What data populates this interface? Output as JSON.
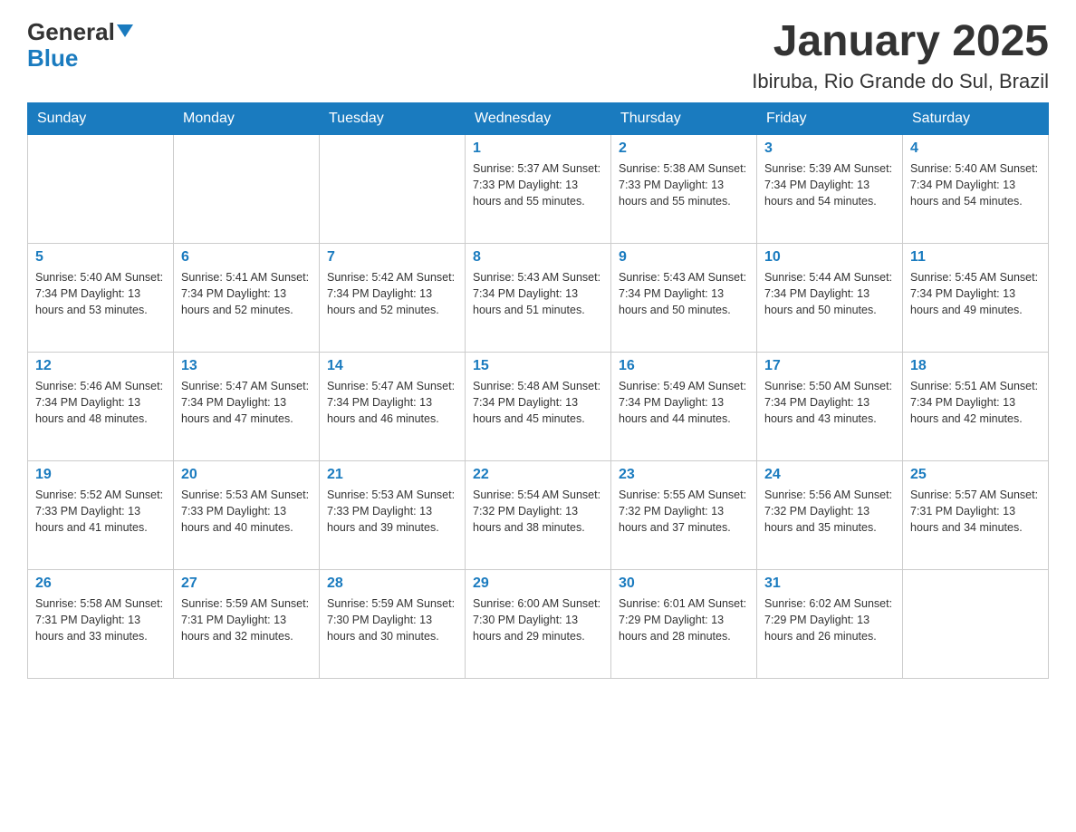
{
  "header": {
    "logo_general": "General",
    "logo_blue": "Blue",
    "month_title": "January 2025",
    "location": "Ibiruba, Rio Grande do Sul, Brazil"
  },
  "days_of_week": [
    "Sunday",
    "Monday",
    "Tuesday",
    "Wednesday",
    "Thursday",
    "Friday",
    "Saturday"
  ],
  "weeks": [
    [
      {
        "day": "",
        "info": ""
      },
      {
        "day": "",
        "info": ""
      },
      {
        "day": "",
        "info": ""
      },
      {
        "day": "1",
        "info": "Sunrise: 5:37 AM\nSunset: 7:33 PM\nDaylight: 13 hours\nand 55 minutes."
      },
      {
        "day": "2",
        "info": "Sunrise: 5:38 AM\nSunset: 7:33 PM\nDaylight: 13 hours\nand 55 minutes."
      },
      {
        "day": "3",
        "info": "Sunrise: 5:39 AM\nSunset: 7:34 PM\nDaylight: 13 hours\nand 54 minutes."
      },
      {
        "day": "4",
        "info": "Sunrise: 5:40 AM\nSunset: 7:34 PM\nDaylight: 13 hours\nand 54 minutes."
      }
    ],
    [
      {
        "day": "5",
        "info": "Sunrise: 5:40 AM\nSunset: 7:34 PM\nDaylight: 13 hours\nand 53 minutes."
      },
      {
        "day": "6",
        "info": "Sunrise: 5:41 AM\nSunset: 7:34 PM\nDaylight: 13 hours\nand 52 minutes."
      },
      {
        "day": "7",
        "info": "Sunrise: 5:42 AM\nSunset: 7:34 PM\nDaylight: 13 hours\nand 52 minutes."
      },
      {
        "day": "8",
        "info": "Sunrise: 5:43 AM\nSunset: 7:34 PM\nDaylight: 13 hours\nand 51 minutes."
      },
      {
        "day": "9",
        "info": "Sunrise: 5:43 AM\nSunset: 7:34 PM\nDaylight: 13 hours\nand 50 minutes."
      },
      {
        "day": "10",
        "info": "Sunrise: 5:44 AM\nSunset: 7:34 PM\nDaylight: 13 hours\nand 50 minutes."
      },
      {
        "day": "11",
        "info": "Sunrise: 5:45 AM\nSunset: 7:34 PM\nDaylight: 13 hours\nand 49 minutes."
      }
    ],
    [
      {
        "day": "12",
        "info": "Sunrise: 5:46 AM\nSunset: 7:34 PM\nDaylight: 13 hours\nand 48 minutes."
      },
      {
        "day": "13",
        "info": "Sunrise: 5:47 AM\nSunset: 7:34 PM\nDaylight: 13 hours\nand 47 minutes."
      },
      {
        "day": "14",
        "info": "Sunrise: 5:47 AM\nSunset: 7:34 PM\nDaylight: 13 hours\nand 46 minutes."
      },
      {
        "day": "15",
        "info": "Sunrise: 5:48 AM\nSunset: 7:34 PM\nDaylight: 13 hours\nand 45 minutes."
      },
      {
        "day": "16",
        "info": "Sunrise: 5:49 AM\nSunset: 7:34 PM\nDaylight: 13 hours\nand 44 minutes."
      },
      {
        "day": "17",
        "info": "Sunrise: 5:50 AM\nSunset: 7:34 PM\nDaylight: 13 hours\nand 43 minutes."
      },
      {
        "day": "18",
        "info": "Sunrise: 5:51 AM\nSunset: 7:34 PM\nDaylight: 13 hours\nand 42 minutes."
      }
    ],
    [
      {
        "day": "19",
        "info": "Sunrise: 5:52 AM\nSunset: 7:33 PM\nDaylight: 13 hours\nand 41 minutes."
      },
      {
        "day": "20",
        "info": "Sunrise: 5:53 AM\nSunset: 7:33 PM\nDaylight: 13 hours\nand 40 minutes."
      },
      {
        "day": "21",
        "info": "Sunrise: 5:53 AM\nSunset: 7:33 PM\nDaylight: 13 hours\nand 39 minutes."
      },
      {
        "day": "22",
        "info": "Sunrise: 5:54 AM\nSunset: 7:32 PM\nDaylight: 13 hours\nand 38 minutes."
      },
      {
        "day": "23",
        "info": "Sunrise: 5:55 AM\nSunset: 7:32 PM\nDaylight: 13 hours\nand 37 minutes."
      },
      {
        "day": "24",
        "info": "Sunrise: 5:56 AM\nSunset: 7:32 PM\nDaylight: 13 hours\nand 35 minutes."
      },
      {
        "day": "25",
        "info": "Sunrise: 5:57 AM\nSunset: 7:31 PM\nDaylight: 13 hours\nand 34 minutes."
      }
    ],
    [
      {
        "day": "26",
        "info": "Sunrise: 5:58 AM\nSunset: 7:31 PM\nDaylight: 13 hours\nand 33 minutes."
      },
      {
        "day": "27",
        "info": "Sunrise: 5:59 AM\nSunset: 7:31 PM\nDaylight: 13 hours\nand 32 minutes."
      },
      {
        "day": "28",
        "info": "Sunrise: 5:59 AM\nSunset: 7:30 PM\nDaylight: 13 hours\nand 30 minutes."
      },
      {
        "day": "29",
        "info": "Sunrise: 6:00 AM\nSunset: 7:30 PM\nDaylight: 13 hours\nand 29 minutes."
      },
      {
        "day": "30",
        "info": "Sunrise: 6:01 AM\nSunset: 7:29 PM\nDaylight: 13 hours\nand 28 minutes."
      },
      {
        "day": "31",
        "info": "Sunrise: 6:02 AM\nSunset: 7:29 PM\nDaylight: 13 hours\nand 26 minutes."
      },
      {
        "day": "",
        "info": ""
      }
    ]
  ]
}
